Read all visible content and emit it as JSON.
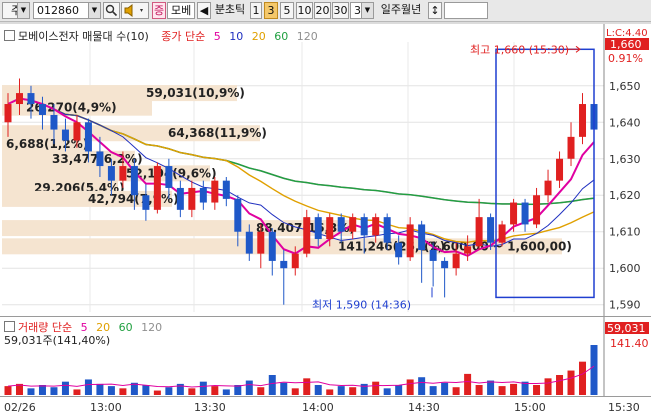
{
  "toolbar": {
    "mode": "주",
    "code": "012860",
    "speed_label": "증",
    "stock_short": "모베",
    "left_arrow": "◀",
    "period_label": "분초틱",
    "intervals": [
      "1",
      "3",
      "5",
      "10",
      "20",
      "30"
    ],
    "selected_interval": "3",
    "count_value": "3",
    "period_tabs": "일주월년",
    "updown": "↕"
  },
  "main": {
    "legend_title": "모베이스전자 매물대 수(10)",
    "ma_label": "종가 단순",
    "ma": [
      {
        "period": "5",
        "color": "#e000a0"
      },
      {
        "period": "10",
        "color": "#2030c0"
      },
      {
        "period": "20",
        "color": "#e0a000"
      },
      {
        "period": "60",
        "color": "#20a040"
      },
      {
        "period": "120",
        "color": "#909090"
      }
    ],
    "y_ticks": [
      "1,650",
      "1,640",
      "1,630",
      "1,620",
      "1,610",
      "1,600",
      "1,590"
    ],
    "y_top_label": "L:C:4.40",
    "current_price": "1,660",
    "current_pct": "0.91%",
    "high_label": "최고 1,660 (15:30)",
    "low_label": "최저 1,590 (14:36)",
    "volume_profile": [
      "59,031(10,9%)",
      "26,270(4,9%)",
      "64,368(11,9%)",
      "6,688(1,2%)",
      "33,477(6,2%)",
      "52,194(9,6%)",
      "29,206(5,4%)",
      "42,794(7,9%)",
      "88,407(16,3%)",
      "141,246(26,1%)"
    ],
    "profile_range": "(1,600,00 ~ 1,600,00)"
  },
  "volume": {
    "legend_title": "거래량 단순",
    "ma": [
      {
        "period": "5",
        "color": "#e000a0"
      },
      {
        "period": "20",
        "color": "#e0a000"
      },
      {
        "period": "60",
        "color": "#20a040"
      },
      {
        "period": "120",
        "color": "#909090"
      }
    ],
    "summary": "59,031주(141,40%)",
    "right_value": "59,031",
    "right_pct": "141.40"
  },
  "x_axis": [
    "02/26",
    "13:00",
    "13:30",
    "14:00",
    "14:30",
    "15:00",
    "15:30"
  ],
  "colors": {
    "up": "#e02020",
    "down": "#1f58c8",
    "profile": "#f5e4d0"
  },
  "chart_data": {
    "type": "candlestick",
    "y_range": [
      1588,
      1662
    ],
    "candles": [
      {
        "o": 1640,
        "c": 1645,
        "h": 1648,
        "l": 1636
      },
      {
        "o": 1645,
        "c": 1648,
        "h": 1652,
        "l": 1642
      },
      {
        "o": 1648,
        "c": 1645,
        "h": 1650,
        "l": 1641
      },
      {
        "o": 1645,
        "c": 1642,
        "h": 1647,
        "l": 1638
      },
      {
        "o": 1642,
        "c": 1638,
        "h": 1645,
        "l": 1634
      },
      {
        "o": 1638,
        "c": 1635,
        "h": 1641,
        "l": 1632
      },
      {
        "o": 1635,
        "c": 1640,
        "h": 1642,
        "l": 1633
      },
      {
        "o": 1640,
        "c": 1632,
        "h": 1641,
        "l": 1629
      },
      {
        "o": 1632,
        "c": 1628,
        "h": 1636,
        "l": 1625
      },
      {
        "o": 1628,
        "c": 1624,
        "h": 1630,
        "l": 1620
      },
      {
        "o": 1624,
        "c": 1628,
        "h": 1632,
        "l": 1622
      },
      {
        "o": 1628,
        "c": 1620,
        "h": 1630,
        "l": 1616
      },
      {
        "o": 1620,
        "c": 1616,
        "h": 1623,
        "l": 1613
      },
      {
        "o": 1616,
        "c": 1628,
        "h": 1629,
        "l": 1615
      },
      {
        "o": 1628,
        "c": 1622,
        "h": 1630,
        "l": 1619
      },
      {
        "o": 1622,
        "c": 1616,
        "h": 1624,
        "l": 1614
      },
      {
        "o": 1616,
        "c": 1622,
        "h": 1624,
        "l": 1614
      },
      {
        "o": 1622,
        "c": 1618,
        "h": 1624,
        "l": 1616
      },
      {
        "o": 1618,
        "c": 1624,
        "h": 1625,
        "l": 1616
      },
      {
        "o": 1624,
        "c": 1619,
        "h": 1625,
        "l": 1617
      },
      {
        "o": 1619,
        "c": 1610,
        "h": 1620,
        "l": 1606
      },
      {
        "o": 1610,
        "c": 1604,
        "h": 1612,
        "l": 1602
      },
      {
        "o": 1604,
        "c": 1610,
        "h": 1612,
        "l": 1600
      },
      {
        "o": 1610,
        "c": 1602,
        "h": 1611,
        "l": 1598
      },
      {
        "o": 1602,
        "c": 1600,
        "h": 1605,
        "l": 1590
      },
      {
        "o": 1600,
        "c": 1604,
        "h": 1606,
        "l": 1598
      },
      {
        "o": 1604,
        "c": 1614,
        "h": 1616,
        "l": 1603
      },
      {
        "o": 1614,
        "c": 1608,
        "h": 1615,
        "l": 1606
      },
      {
        "o": 1608,
        "c": 1614,
        "h": 1615,
        "l": 1606
      },
      {
        "o": 1614,
        "c": 1610,
        "h": 1615,
        "l": 1607
      },
      {
        "o": 1610,
        "c": 1614,
        "h": 1615,
        "l": 1608
      },
      {
        "o": 1614,
        "c": 1609,
        "h": 1615,
        "l": 1604
      },
      {
        "o": 1609,
        "c": 1614,
        "h": 1615,
        "l": 1607
      },
      {
        "o": 1614,
        "c": 1607,
        "h": 1615,
        "l": 1605
      },
      {
        "o": 1607,
        "c": 1603,
        "h": 1609,
        "l": 1601
      },
      {
        "o": 1603,
        "c": 1612,
        "h": 1614,
        "l": 1602
      },
      {
        "o": 1612,
        "c": 1605,
        "h": 1613,
        "l": 1596
      },
      {
        "o": 1605,
        "c": 1602,
        "h": 1607,
        "l": 1595
      },
      {
        "o": 1602,
        "c": 1600,
        "h": 1603,
        "l": 1592
      },
      {
        "o": 1600,
        "c": 1604,
        "h": 1607,
        "l": 1598
      },
      {
        "o": 1604,
        "c": 1606,
        "h": 1609,
        "l": 1602
      },
      {
        "o": 1606,
        "c": 1614,
        "h": 1619,
        "l": 1605
      },
      {
        "o": 1614,
        "c": 1607,
        "h": 1615,
        "l": 1605
      },
      {
        "o": 1607,
        "c": 1612,
        "h": 1613,
        "l": 1606
      },
      {
        "o": 1612,
        "c": 1618,
        "h": 1619,
        "l": 1610
      },
      {
        "o": 1618,
        "c": 1612,
        "h": 1619,
        "l": 1610
      },
      {
        "o": 1612,
        "c": 1620,
        "h": 1622,
        "l": 1611
      },
      {
        "o": 1620,
        "c": 1624,
        "h": 1627,
        "l": 1618
      },
      {
        "o": 1624,
        "c": 1630,
        "h": 1632,
        "l": 1622
      },
      {
        "o": 1630,
        "c": 1636,
        "h": 1640,
        "l": 1628
      },
      {
        "o": 1636,
        "c": 1645,
        "h": 1648,
        "l": 1634
      },
      {
        "o": 1645,
        "c": 1638,
        "h": 1647,
        "l": 1633
      }
    ],
    "volumes": [
      8,
      10,
      6,
      9,
      7,
      12,
      5,
      14,
      10,
      8,
      6,
      11,
      9,
      4,
      7,
      10,
      6,
      12,
      8,
      5,
      9,
      13,
      7,
      18,
      11,
      6,
      15,
      9,
      5,
      8,
      7,
      10,
      12,
      6,
      9,
      14,
      16,
      8,
      11,
      7,
      19,
      9,
      13,
      8,
      10,
      12,
      9,
      15,
      18,
      22,
      30,
      45
    ]
  }
}
